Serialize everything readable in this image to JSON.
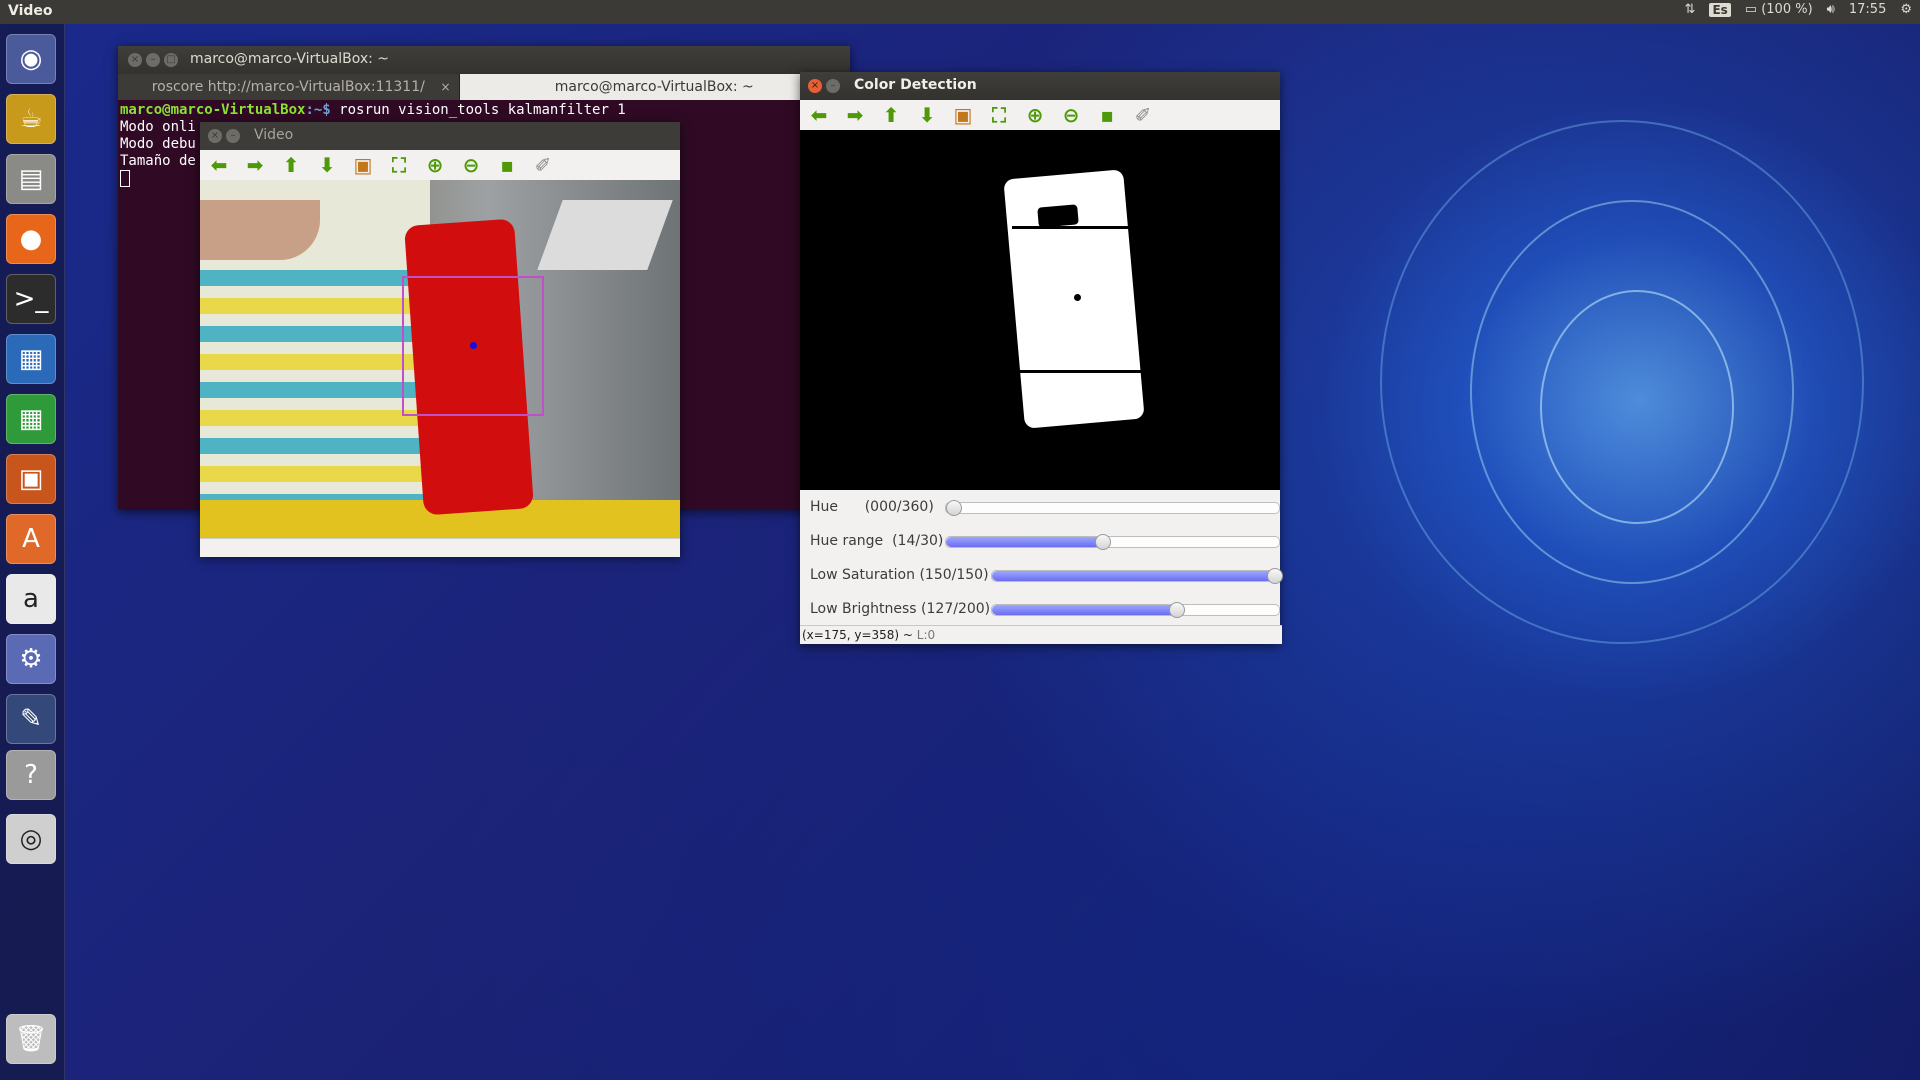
{
  "top_panel": {
    "app_title": "Video",
    "keyboard_layout": "Es",
    "battery": "(100 %)",
    "time": "17:55"
  },
  "launcher": {
    "items": [
      {
        "name": "dash-icon",
        "glyph": "◉",
        "color": "#4a5a9a"
      },
      {
        "name": "teapot-icon",
        "glyph": "☕",
        "color": "#c89a1c"
      },
      {
        "name": "files-icon",
        "glyph": "▤",
        "color": "#8a8a86"
      },
      {
        "name": "firefox-icon",
        "glyph": "●",
        "color": "#e8661a"
      },
      {
        "name": "terminal-icon",
        "glyph": ">_",
        "color": "#2c2c2c"
      },
      {
        "name": "writer-icon",
        "glyph": "▦",
        "color": "#2a6ab8"
      },
      {
        "name": "calc-icon",
        "glyph": "▦",
        "color": "#2f9a3a"
      },
      {
        "name": "impress-icon",
        "glyph": "▣",
        "color": "#c8551c"
      },
      {
        "name": "software-center-icon",
        "glyph": "A",
        "color": "#e0692a"
      },
      {
        "name": "amazon-icon",
        "glyph": "a",
        "color": "#e9e9e9"
      },
      {
        "name": "settings-icon",
        "glyph": "⚙",
        "color": "#5a6ab4"
      },
      {
        "name": "editor-icon",
        "glyph": "✎",
        "color": "#34487a"
      },
      {
        "name": "help-icon",
        "glyph": "?",
        "color": "#9a9a9a"
      },
      {
        "name": "dvd-icon",
        "glyph": "◎",
        "color": "#cfcfcf"
      },
      {
        "name": "trash-icon",
        "glyph": "🗑",
        "color": "#bdbdbd"
      }
    ]
  },
  "terminal": {
    "window_title": "marco@marco-VirtualBox: ~",
    "tabs": [
      {
        "label": "roscore http://marco-VirtualBox:11311/",
        "active": false
      },
      {
        "label": "marco@marco-VirtualBox: ~",
        "active": true
      }
    ],
    "prompt_user": "marco@marco-VirtualBox",
    "prompt_path": ":~$",
    "command": " rosrun vision_tools kalmanfilter 1",
    "output_lines": [
      "Modo onli",
      "Modo debu",
      "Tamaño de"
    ]
  },
  "video_window": {
    "title": "Video"
  },
  "color_detection": {
    "title": "Color Detection",
    "status_coords": "(x=175, y=358) ~ ",
    "status_extra": "L:0",
    "sliders": [
      {
        "name": "hue-slider",
        "label": "Hue      (000/360)",
        "value": 0,
        "max": 360
      },
      {
        "name": "hue-range-slider",
        "label": "Hue range  (14/30)",
        "value": 14,
        "max": 30
      },
      {
        "name": "low-saturation-slider",
        "label": "Low Saturation (150/150)",
        "value": 150,
        "max": 150
      },
      {
        "name": "low-brightness-slider",
        "label": "Low Brightness (127/200)",
        "value": 127,
        "max": 200
      }
    ]
  }
}
